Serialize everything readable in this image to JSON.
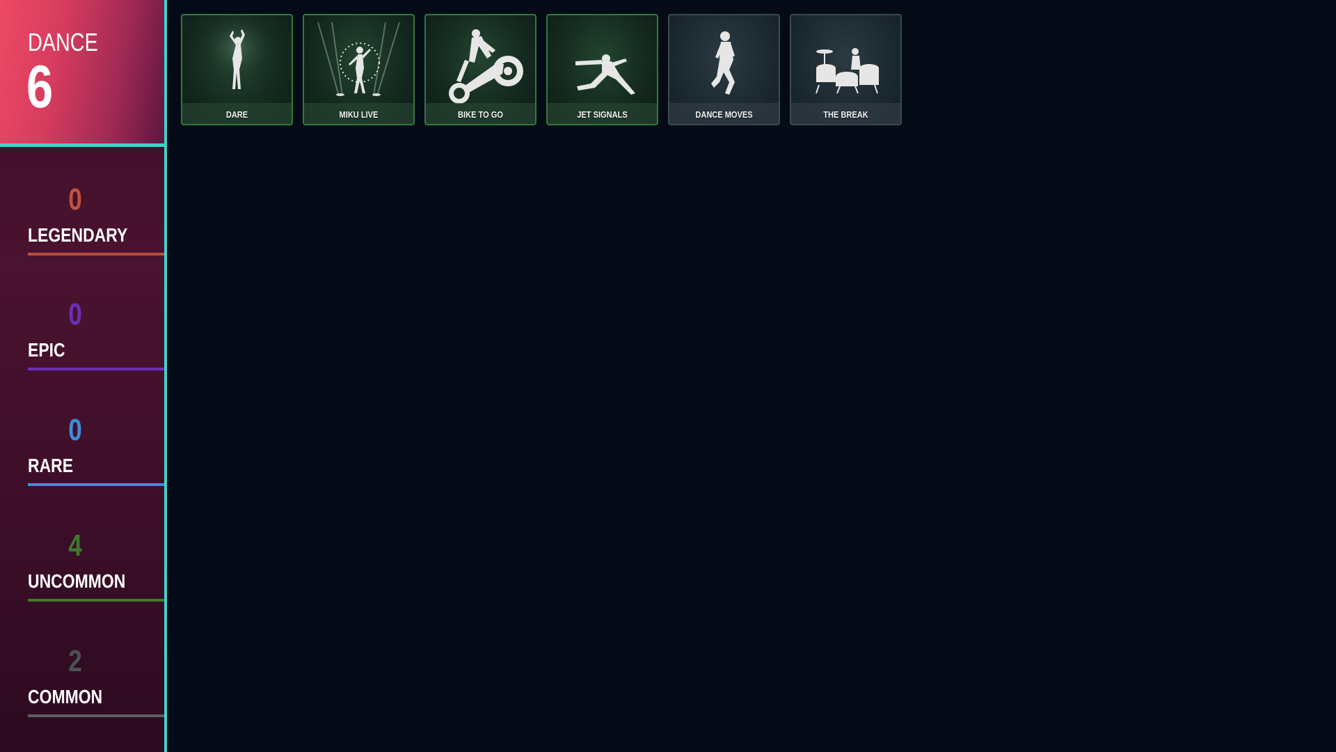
{
  "category": {
    "name": "DANCE",
    "count": "6"
  },
  "rarities": [
    {
      "count": "0",
      "label": "LEGENDARY",
      "color": "#c0523c",
      "bar_color": "#b84e3a"
    },
    {
      "count": "0",
      "label": "EPIC",
      "color": "#6a2fb8",
      "bar_color": "#6a2fb8"
    },
    {
      "count": "0",
      "label": "RARE",
      "color": "#3c8ed8",
      "bar_color": "#3b8fd9"
    },
    {
      "count": "4",
      "label": "UNCOMMON",
      "color": "#3f7a2e",
      "bar_color": "#3f7a2e"
    },
    {
      "count": "2",
      "label": "COMMON",
      "color": "#4a5258",
      "bar_color": "#5a6066"
    }
  ],
  "items": [
    {
      "name": "DARE",
      "rarity": "uncommon",
      "icon": "dancer-pose-icon"
    },
    {
      "name": "MIKU LIVE",
      "rarity": "uncommon",
      "icon": "stage-performer-icon"
    },
    {
      "name": "BIKE TO GO",
      "rarity": "uncommon",
      "icon": "motorbike-rider-icon"
    },
    {
      "name": "JET SIGNALS",
      "rarity": "uncommon",
      "icon": "lunging-pose-icon"
    },
    {
      "name": "DANCE MOVES",
      "rarity": "common",
      "icon": "default-dance-icon"
    },
    {
      "name": "THE BREAK",
      "rarity": "common",
      "icon": "drum-kit-icon"
    }
  ],
  "colors": {
    "background": "#040b17",
    "accent_line": "#3fd3c8",
    "header_gradient_start": "#ee4a64",
    "uncommon_border": "#2f7a3a",
    "common_border": "#3a4a52"
  }
}
